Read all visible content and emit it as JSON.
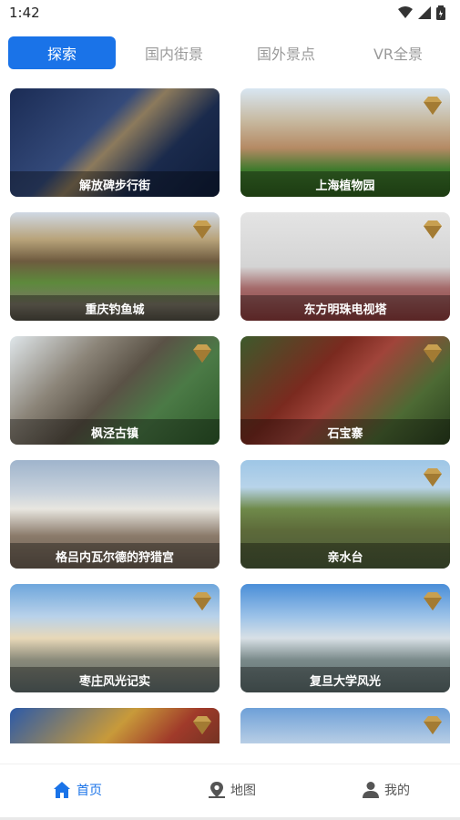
{
  "status": {
    "time": "1:42"
  },
  "tabs": [
    {
      "label": "探索"
    },
    {
      "label": "国内街景"
    },
    {
      "label": "国外景点"
    },
    {
      "label": "VR全景"
    }
  ],
  "cards": [
    {
      "title": "解放碑步行街",
      "vr": false
    },
    {
      "title": "上海植物园",
      "vr": true
    },
    {
      "title": "重庆钓鱼城",
      "vr": true
    },
    {
      "title": "东方明珠电视塔",
      "vr": true
    },
    {
      "title": "枫泾古镇",
      "vr": true
    },
    {
      "title": "石宝寨",
      "vr": true
    },
    {
      "title": "格吕内瓦尔德的狩猎宫",
      "vr": false
    },
    {
      "title": "亲水台",
      "vr": true
    },
    {
      "title": "枣庄风光记实",
      "vr": true
    },
    {
      "title": "复旦大学风光",
      "vr": true
    },
    {
      "title": "",
      "vr": true
    },
    {
      "title": "",
      "vr": true
    }
  ],
  "nav": [
    {
      "label": "首页",
      "icon": "home-icon"
    },
    {
      "label": "地图",
      "icon": "map-pin-icon"
    },
    {
      "label": "我的",
      "icon": "user-icon"
    }
  ],
  "colors": {
    "accent": "#1a73e8",
    "vr_gold": "#c8a050"
  }
}
